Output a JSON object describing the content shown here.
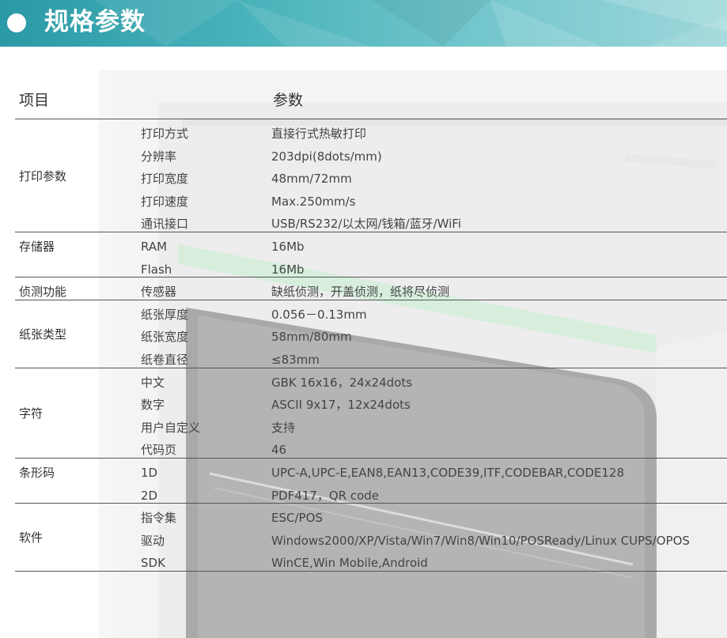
{
  "header": {
    "title": "规格参数"
  },
  "table": {
    "col_item": "项目",
    "col_param": "参数",
    "groups": [
      {
        "label": "打印参数",
        "rows": [
          {
            "key": "打印方式",
            "value": "直接行式热敏打印"
          },
          {
            "key": "分辨率",
            "value": "203dpi(8dots/mm)"
          },
          {
            "key": "打印宽度",
            "value": "48mm/72mm"
          },
          {
            "key": "打印速度",
            "value": "Max.250mm/s"
          },
          {
            "key": "通讯接口",
            "value": "USB/RS232/以太网/钱箱/蓝牙/WiFi"
          }
        ]
      },
      {
        "label": "存储器",
        "rows": [
          {
            "key": "RAM",
            "value": "16Mb"
          },
          {
            "key": "Flash",
            "value": "16Mb"
          }
        ]
      },
      {
        "label": "侦测功能",
        "rows": [
          {
            "key": "传感器",
            "value": "缺纸侦测，开盖侦测，纸将尽侦测"
          }
        ]
      },
      {
        "label": "纸张类型",
        "rows": [
          {
            "key": "纸张厚度",
            "value": "0.056－0.13mm"
          },
          {
            "key": "纸张宽度",
            "value": "58mm/80mm"
          },
          {
            "key": "纸卷直径",
            "value": "≤83mm"
          }
        ]
      },
      {
        "label": "字符",
        "rows": [
          {
            "key": "中文",
            "value": "GBK 16x16，24x24dots"
          },
          {
            "key": "数字",
            "value": "ASCII 9x17，12x24dots"
          },
          {
            "key": "用户自定义",
            "value": "支持"
          },
          {
            "key": "代码页",
            "value": "46"
          }
        ]
      },
      {
        "label": "条形码",
        "rows": [
          {
            "key": "1D",
            "value": "UPC-A,UPC-E,EAN8,EAN13,CODE39,ITF,CODEBAR,CODE128"
          },
          {
            "key": "2D",
            "value": "PDF417，QR code"
          }
        ]
      },
      {
        "label": "软件",
        "rows": [
          {
            "key": "指令集",
            "value": "ESC/POS"
          },
          {
            "key": "驱动",
            "value": "Windows2000/XP/Vista/Win7/Win8/Win10/POSReady/Linux CUPS/OPOS"
          },
          {
            "key": "SDK",
            "value": "WinCE,Win Mobile,Android"
          }
        ]
      }
    ]
  }
}
